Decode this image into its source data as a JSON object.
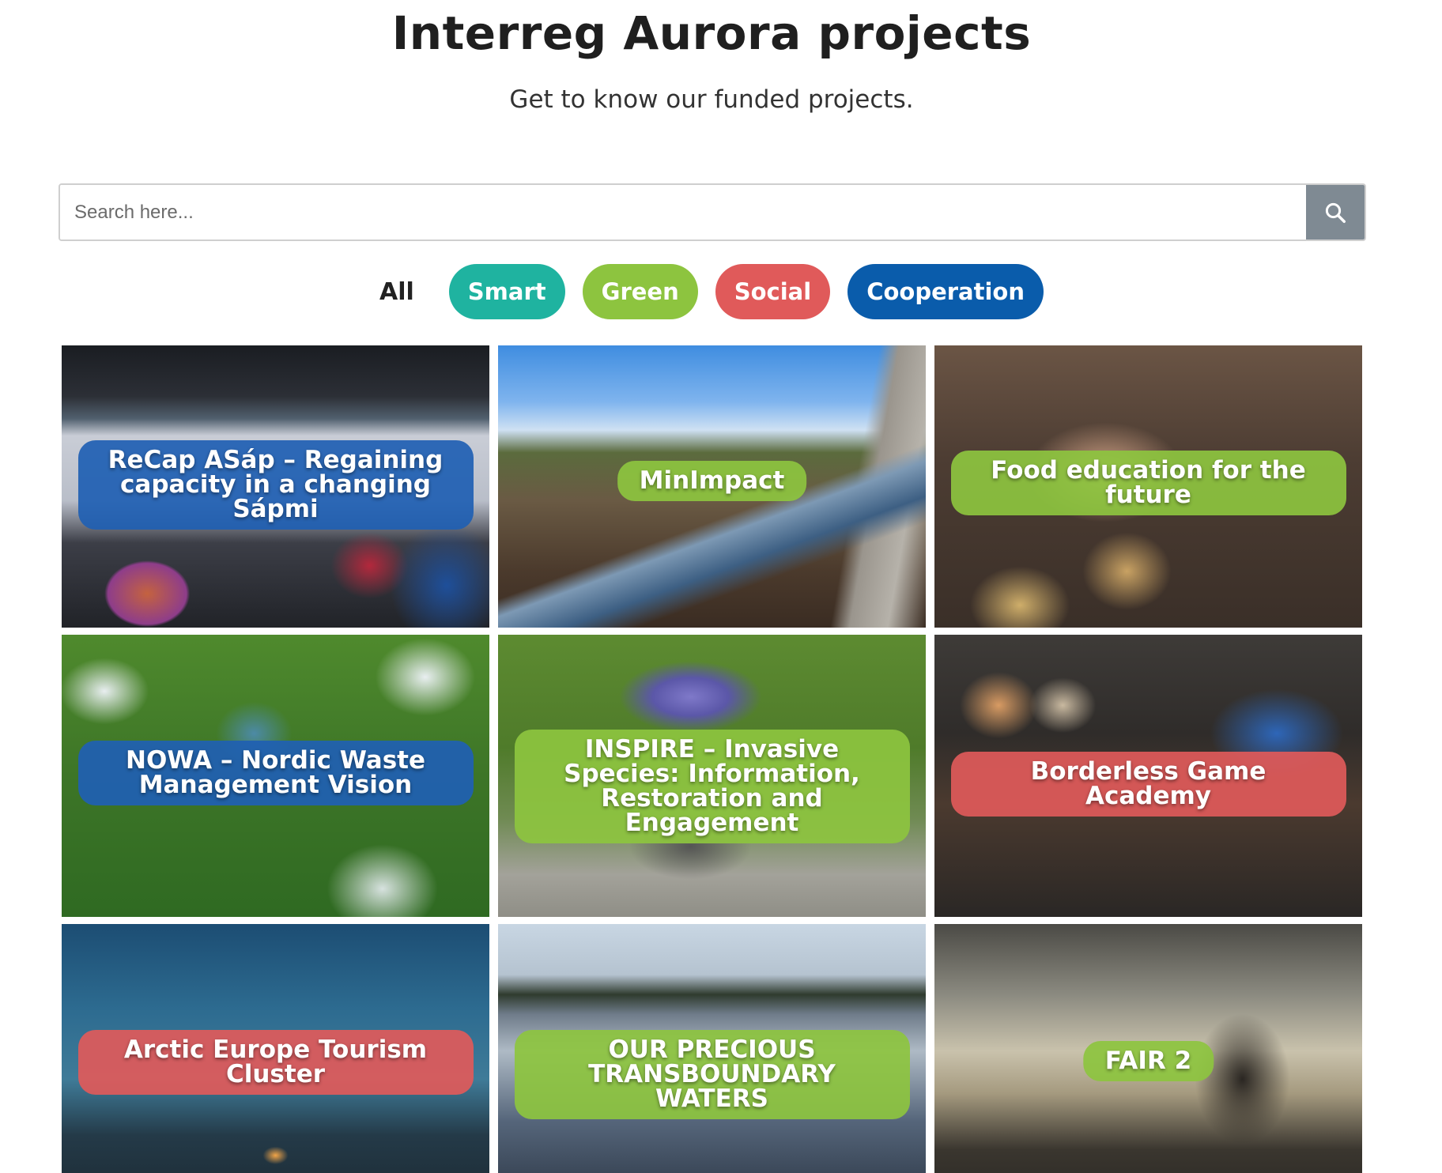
{
  "header": {
    "title": "Interreg Aurora projects",
    "subtitle": "Get to know our funded projects."
  },
  "search": {
    "placeholder": "Search here...",
    "button_icon": "search-icon"
  },
  "filters": {
    "all_label": "All",
    "pills": [
      {
        "label": "Smart",
        "color": "#1fb3a0"
      },
      {
        "label": "Green",
        "color": "#8dc43f"
      },
      {
        "label": "Social",
        "color": "#e05a5a"
      },
      {
        "label": "Cooperation",
        "color": "#0a5cab"
      }
    ]
  },
  "projects": [
    {
      "title": "ReCap ASáp – Regaining capacity in a changing Sápmi",
      "category": "Cooperation",
      "label_color": "#1f5fb3"
    },
    {
      "title": "MinImpact",
      "category": "Green",
      "label_color": "#8dc43f"
    },
    {
      "title": "Food education for the future",
      "category": "Green",
      "label_color": "#8dc43f"
    },
    {
      "title": "NOWA – Nordic Waste Management Vision",
      "category": "Cooperation",
      "label_color": "#1f5fb3"
    },
    {
      "title": "INSPIRE – Invasive Species: Information, Restoration and Engagement",
      "category": "Green",
      "label_color": "#8dc43f"
    },
    {
      "title": "Borderless Game Academy",
      "category": "Social",
      "label_color": "#e05a5a"
    },
    {
      "title": "Arctic Europe Tourism Cluster",
      "category": "Social",
      "label_color": "#e05a5a"
    },
    {
      "title": "OUR PRECIOUS TRANSBOUNDARY WATERS",
      "category": "Green",
      "label_color": "#8dc43f"
    },
    {
      "title": "FAIR 2",
      "category": "Green",
      "label_color": "#8dc43f"
    }
  ]
}
